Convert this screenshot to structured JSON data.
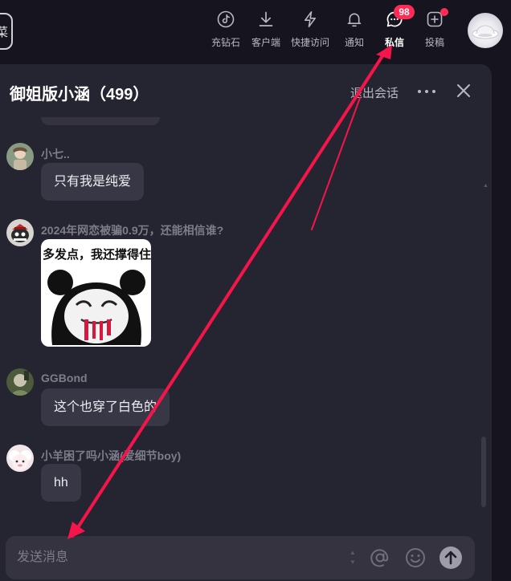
{
  "nav": {
    "left_edge_glyph": "菜",
    "items": [
      {
        "label": "充钻石",
        "icon": "tiktok-icon"
      },
      {
        "label": "客户端",
        "icon": "download-icon"
      },
      {
        "label": "快捷访问",
        "icon": "lightning-icon"
      },
      {
        "label": "通知",
        "icon": "bell-icon"
      },
      {
        "label": "私信",
        "icon": "message-icon",
        "active": true,
        "badge": "98"
      },
      {
        "label": "投稿",
        "icon": "plus-square-icon",
        "dot": true
      }
    ]
  },
  "chat": {
    "title": "御姐版小涵（499）",
    "exit_label": "退出会话"
  },
  "messages": [
    {
      "sender": "小七..",
      "text": "只有我是纯爱"
    },
    {
      "sender": "2024年网恋被骗0.9万，还能相信谁?",
      "sticker_caption": "多发点，我还撑得住"
    },
    {
      "sender": "GGBond",
      "text": "这个也穿了白色的"
    },
    {
      "sender": "小羊困了吗小涵(爱细节boy)",
      "text": "hh"
    }
  ],
  "composer": {
    "placeholder": "发送消息",
    "mention_glyph": "@"
  },
  "colors": {
    "accent": "#fe2c55",
    "annotation_arrow": "#f5154a",
    "panel_bg": "#252431",
    "bubble_bg": "#383745"
  }
}
